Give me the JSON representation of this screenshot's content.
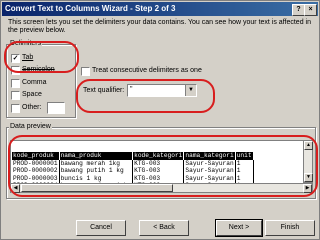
{
  "window": {
    "title": "Convert Text to Columns Wizard - Step 2 of 3"
  },
  "titlebar_buttons": {
    "help": "?",
    "close": "×"
  },
  "intro": "This screen lets you set the delimiters your data contains.  You can see how your text is affected in the preview below.",
  "delimiters": {
    "legend": "Delimiters",
    "items": [
      {
        "label": "Tab",
        "checked": true
      },
      {
        "label": "Semicolon",
        "checked": false
      },
      {
        "label": "Comma",
        "checked": false
      },
      {
        "label": "Space",
        "checked": false
      },
      {
        "label": "Other:",
        "checked": false
      }
    ]
  },
  "consecutive": {
    "label": "Treat consecutive delimiters as one",
    "checked": false
  },
  "text_qualifier": {
    "label": "Text qualifier:",
    "value": "\""
  },
  "data_preview": {
    "legend": "Data preview",
    "columns": [
      "kode_produk",
      "nama_produk",
      "kode_kategori",
      "nama_kategori",
      "unit"
    ],
    "rows": [
      [
        "PROD-0000001",
        "bawang merah 1kg",
        "KTG-003",
        "Sayur-Sayuran",
        "1"
      ],
      [
        "PROD-0000002",
        "bawang putih 1 kg",
        "KTG-003",
        "Sayur-Sayuran",
        "1"
      ],
      [
        "PROD-0000003",
        "buncis 1 kg",
        "KTG-003",
        "Sayur-Sayuran",
        "1"
      ],
      [
        "PROD-0000004",
        "kacang panjang 1 kg",
        "KTG-003",
        "Sayur-Sayuran",
        "1"
      ]
    ]
  },
  "buttons": {
    "cancel": "Cancel",
    "back": "< Back",
    "next": "Next >",
    "finish": "Finish"
  },
  "check_mark": "✓",
  "colors": {
    "annotation": "#d81e1e",
    "titlebar": "#0a246a",
    "face": "#d4d0c8"
  }
}
